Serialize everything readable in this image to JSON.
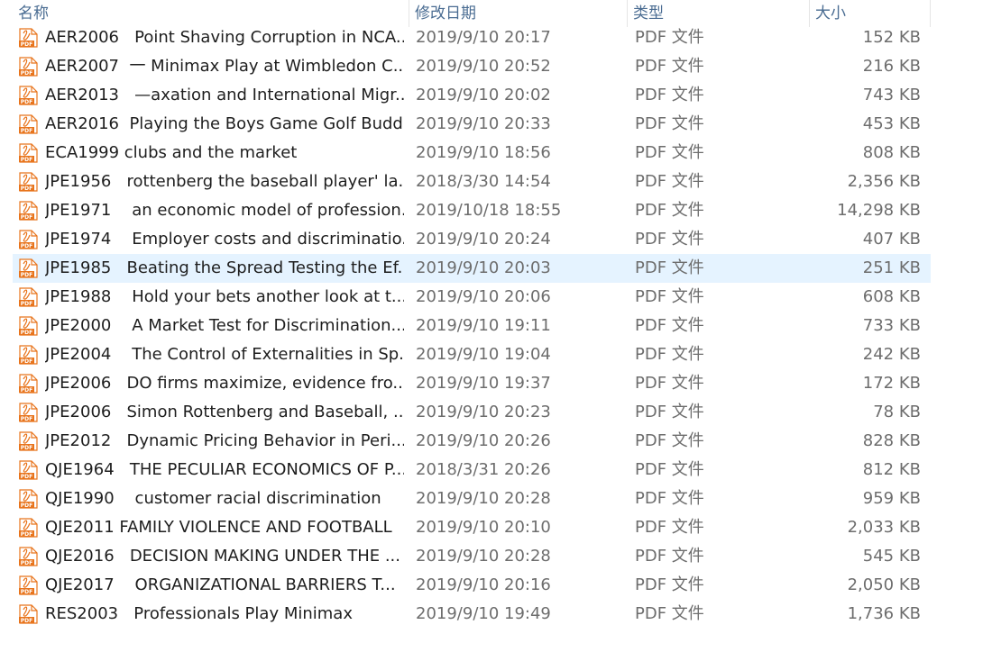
{
  "columns": {
    "name": "名称",
    "date": "修改日期",
    "type": "类型",
    "size": "大小"
  },
  "icon": "pdf-file-icon",
  "accent": "#e5f3ff",
  "pdf_color": "#e8741c",
  "files": [
    {
      "name": "AER2006   Point Shaving Corruption in NCA...",
      "date": "2019/9/10 20:17",
      "type": "PDF 文件",
      "size": "152 KB"
    },
    {
      "name": "AER2007  一 Minimax Play at Wimbledon C...",
      "date": "2019/9/10 20:52",
      "type": "PDF 文件",
      "size": "216 KB"
    },
    {
      "name": "AER2013   —axation and International Migr...",
      "date": "2019/9/10 20:02",
      "type": "PDF 文件",
      "size": "743 KB"
    },
    {
      "name": "AER2016  Playing the Boys Game Golf Budd...",
      "date": "2019/9/10 20:33",
      "type": "PDF 文件",
      "size": "453 KB"
    },
    {
      "name": "ECA1999 clubs and the market",
      "date": "2019/9/10 18:56",
      "type": "PDF 文件",
      "size": "808 KB"
    },
    {
      "name": "JPE1956   rottenberg the baseball player' la...",
      "date": "2018/3/30 14:54",
      "type": "PDF 文件",
      "size": "2,356 KB"
    },
    {
      "name": "JPE1971    an economic model of profession...",
      "date": "2019/10/18 18:55",
      "type": "PDF 文件",
      "size": "14,298 KB"
    },
    {
      "name": "JPE1974    Employer costs and discriminatio...",
      "date": "2019/9/10 20:24",
      "type": "PDF 文件",
      "size": "407 KB"
    },
    {
      "name": "JPE1985   Beating the Spread Testing the Ef...",
      "date": "2019/9/10 20:03",
      "type": "PDF 文件",
      "size": "251 KB",
      "selected": true
    },
    {
      "name": "JPE1988    Hold your bets another look at t...",
      "date": "2019/9/10 20:06",
      "type": "PDF 文件",
      "size": "608 KB"
    },
    {
      "name": "JPE2000    A Market Test for Discrimination...",
      "date": "2019/9/10 19:11",
      "type": "PDF 文件",
      "size": "733 KB"
    },
    {
      "name": "JPE2004    The Control of Externalities in Sp...",
      "date": "2019/9/10 19:04",
      "type": "PDF 文件",
      "size": "242 KB"
    },
    {
      "name": "JPE2006   DO firms maximize, evidence fro...",
      "date": "2019/9/10 19:37",
      "type": "PDF 文件",
      "size": "172 KB"
    },
    {
      "name": "JPE2006   Simon Rottenberg and Baseball, ...",
      "date": "2019/9/10 20:23",
      "type": "PDF 文件",
      "size": "78 KB"
    },
    {
      "name": "JPE2012   Dynamic Pricing Behavior in Peri...",
      "date": "2019/9/10 20:26",
      "type": "PDF 文件",
      "size": "828 KB"
    },
    {
      "name": "QJE1964   THE PECULIAR ECONOMICS OF P...",
      "date": "2018/3/31 20:26",
      "type": "PDF 文件",
      "size": "812 KB"
    },
    {
      "name": "QJE1990    customer racial discrimination",
      "date": "2019/9/10 20:28",
      "type": "PDF 文件",
      "size": "959 KB"
    },
    {
      "name": "QJE2011 FAMILY VIOLENCE AND FOOTBALL",
      "date": "2019/9/10 20:10",
      "type": "PDF 文件",
      "size": "2,033 KB"
    },
    {
      "name": "QJE2016   DECISION MAKING UNDER THE ...",
      "date": "2019/9/10 20:28",
      "type": "PDF 文件",
      "size": "545 KB"
    },
    {
      "name": "QJE2017    ORGANIZATIONAL BARRIERS T...",
      "date": "2019/9/10 20:16",
      "type": "PDF 文件",
      "size": "2,050 KB"
    },
    {
      "name": "RES2003   Professionals Play Minimax",
      "date": "2019/9/10 19:49",
      "type": "PDF 文件",
      "size": "1,736 KB"
    }
  ]
}
